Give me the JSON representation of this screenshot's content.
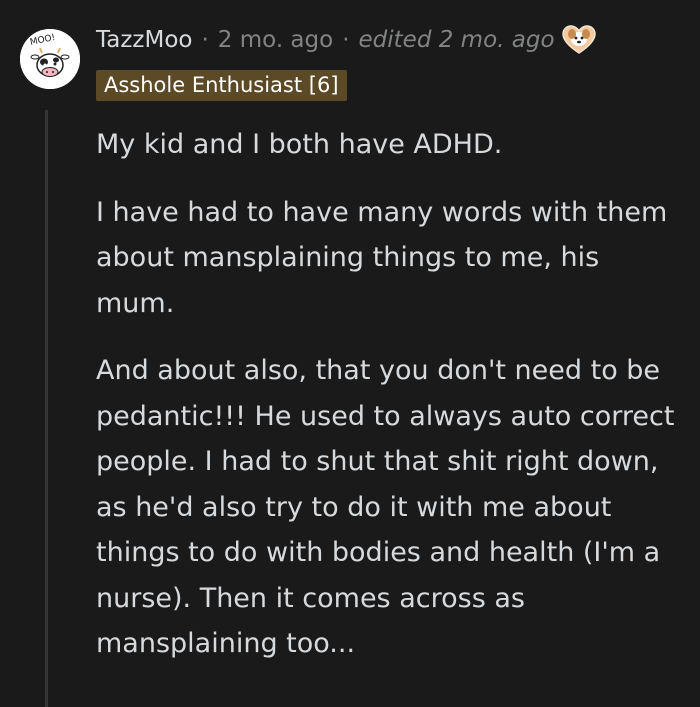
{
  "comment": {
    "username": "TazzMoo",
    "separator": "·",
    "timestamp": "2 mo. ago",
    "edited": "edited 2 mo. ago",
    "award_icon": "dog-face-heart-award-icon",
    "avatar_icon": "cow-avatar",
    "avatar_text": "MOO!",
    "flair": "Asshole Enthusiast [6]",
    "paragraphs": [
      "My kid and I both have ADHD.",
      "I have had to have many words with them about mansplaining things to me, his mum.",
      "And about also, that you don't need to be pedantic!!! He used to always auto correct people. I had to shut that shit right down, as he'd also try to do it with me about things to do with bodies and health (I'm a nurse). Then it comes across as mansplaining too..."
    ]
  },
  "colors": {
    "background": "#1a1a1b",
    "text": "#d7dadc",
    "meta": "#818384",
    "flair_bg": "#5c4a26",
    "thread_line": "#343536"
  }
}
